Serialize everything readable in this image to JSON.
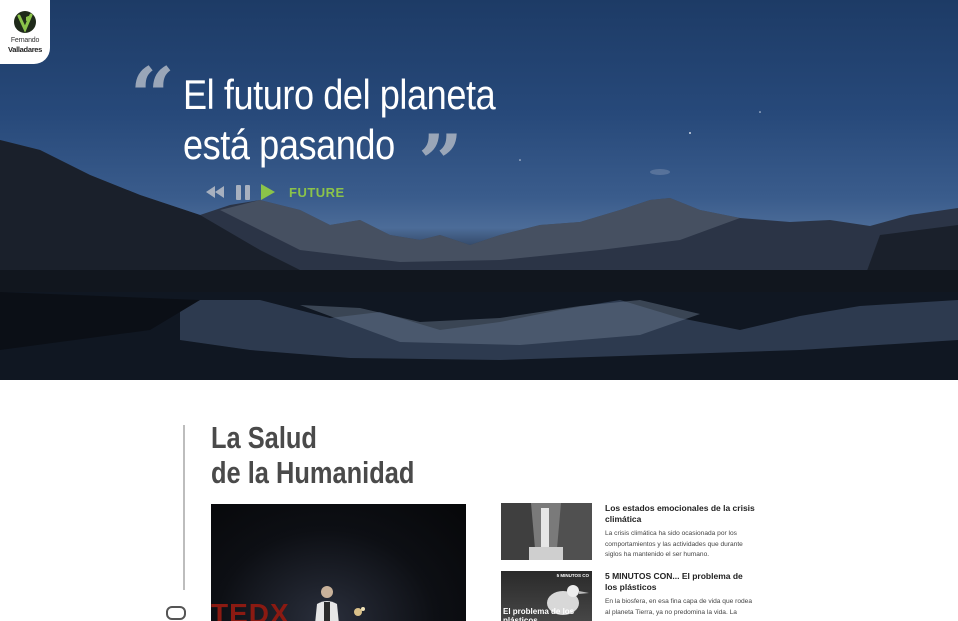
{
  "logo": {
    "name_line1": "Fernando",
    "name_line2": "Valladares",
    "brand_color": "#8bc34a"
  },
  "hero": {
    "quote_open": "“",
    "quote_close": "”",
    "title_line1": "El futuro del planeta",
    "title_line2": "está pasando",
    "controls": {
      "rewind_icon": "rewind-icon",
      "pause_icon": "pause-icon",
      "play_icon": "play-icon",
      "label": "FUTURE"
    }
  },
  "section": {
    "title_line1": "La Salud",
    "title_line2": "de la Humanidad"
  },
  "video": {
    "overlay_text": "TEDX"
  },
  "articles": [
    {
      "title": "Los estados emocionales de la crisis climática",
      "excerpt": "La crisis climática ha sido ocasionada por los comportamientos y las actividades que durante siglos ha mantenido el ser humano."
    },
    {
      "title": "5 MINUTOS CON... El problema de los plásticos",
      "excerpt": "En la biosfera, en esa fina capa de vida que rodea al planeta Tierra, ya no predomina la vida. La",
      "thumb_tag": "5 MINUTOS CO",
      "thumb_caption": "El problema de los plásticos"
    }
  ]
}
